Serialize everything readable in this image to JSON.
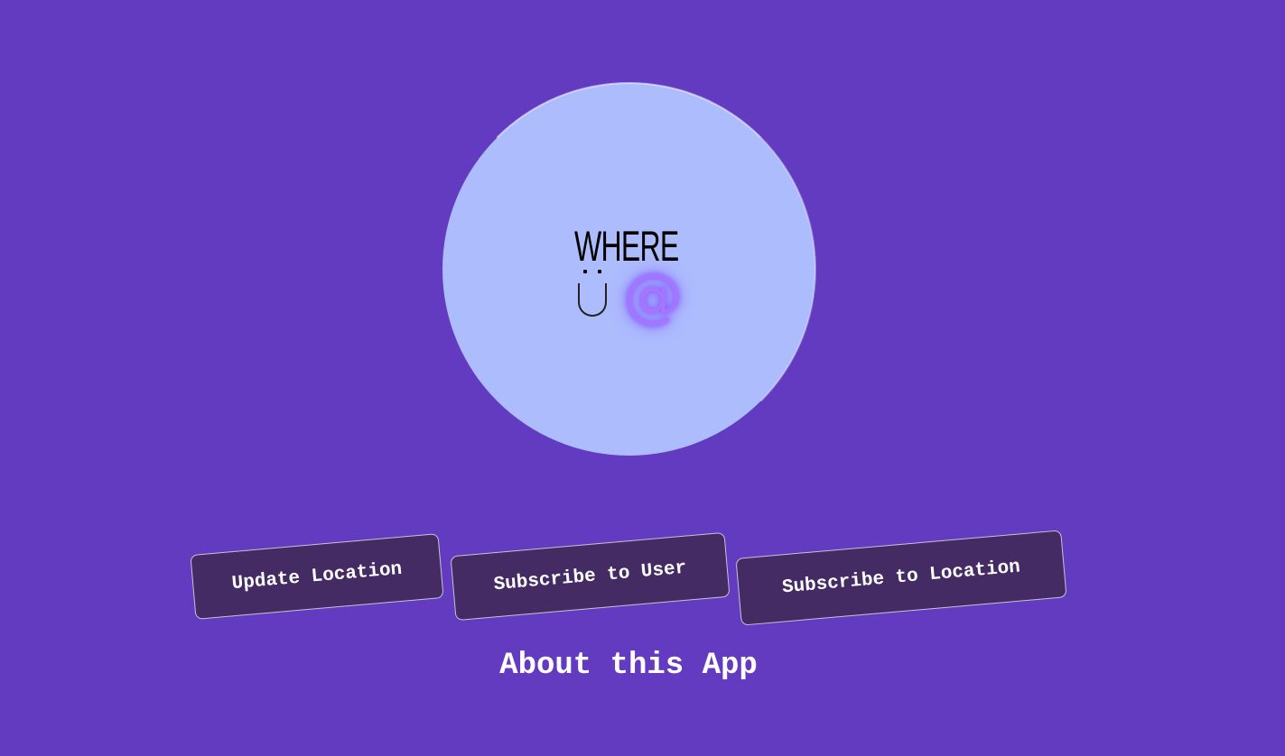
{
  "logo": {
    "word": "WHERE",
    "at_symbol": "@"
  },
  "actions": {
    "update_location": "Update Location",
    "subscribe_user": "Subscribe to User",
    "subscribe_location": "Subscribe to Location"
  },
  "footer": {
    "about": "About this App"
  },
  "colors": {
    "background": "#633bc1",
    "logo_circle": "#adbcfd",
    "button_bg": "#452b64",
    "at_glow": "#a774ff"
  }
}
